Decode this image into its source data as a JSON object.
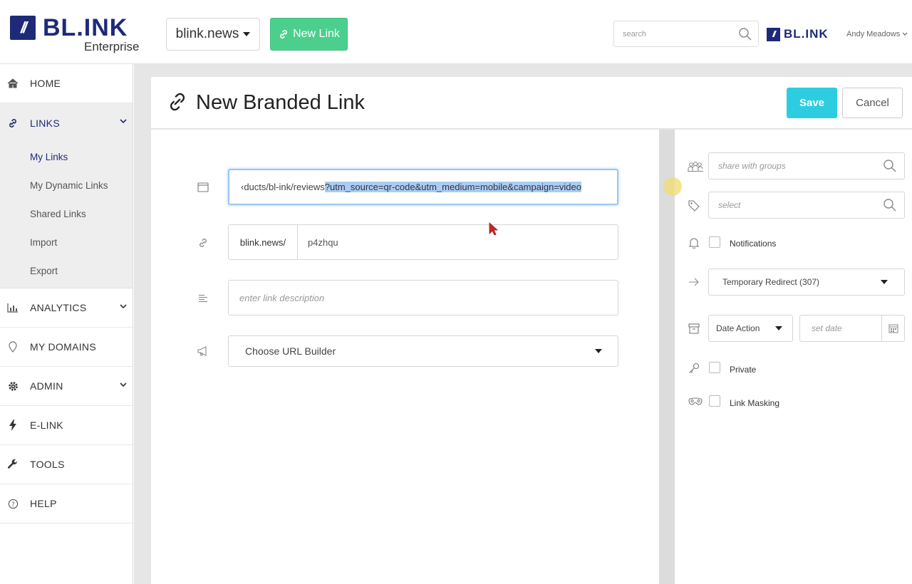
{
  "header": {
    "logo_text": "BL.INK",
    "logo_mark": "//",
    "logo_sub": "Enterprise",
    "domain_selector": "blink.news",
    "new_link_label": "New Link",
    "search_placeholder": "search",
    "brand_small": "BL.INK",
    "user_name": "Andy Meadows"
  },
  "sidebar": {
    "items": [
      {
        "label": "HOME",
        "icon": "home-icon"
      },
      {
        "label": "LINKS",
        "icon": "link-icon",
        "active": true
      },
      {
        "label": "ANALYTICS",
        "icon": "bar-chart-icon"
      },
      {
        "label": "MY DOMAINS",
        "icon": "map-pin-icon"
      },
      {
        "label": "ADMIN",
        "icon": "gear-icon"
      },
      {
        "label": "E-LINK",
        "icon": "bolt-icon"
      },
      {
        "label": "TOOLS",
        "icon": "wrench-icon"
      },
      {
        "label": "HELP",
        "icon": "help-circle-icon"
      }
    ],
    "links_subitems": [
      "My Links",
      "My Dynamic Links",
      "Shared Links",
      "Import",
      "Export"
    ]
  },
  "page": {
    "title": "New Branded Link",
    "save_label": "Save",
    "cancel_label": "Cancel"
  },
  "form": {
    "url_prefix": "‹ducts/bl-ink/reviews",
    "url_selected": "?utm_source=qr-code&utm_medium=mobile&campaign=video",
    "slug_prefix": "blink.news/",
    "slug_value": "p4zhqu",
    "description_placeholder": "enter link description",
    "url_builder": "Choose URL Builder"
  },
  "side_panel": {
    "groups_placeholder": "share with groups",
    "tags_placeholder": "select",
    "notifications_label": "Notifications",
    "redirect_type": "Temporary Redirect (307)",
    "date_action": "Date Action",
    "date_placeholder": "set date",
    "private_label": "Private",
    "link_masking_label": "Link Masking"
  },
  "colors": {
    "brand": "#1e2a78",
    "new_link_green": "#4ccf8d",
    "save_cyan": "#2ccde0",
    "selection": "#a9cdf3"
  }
}
